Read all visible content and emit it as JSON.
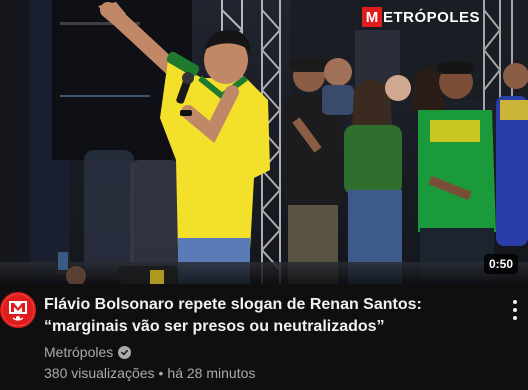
{
  "thumbnail": {
    "logo_initial": "M",
    "logo_rest": "ETRÓPOLES",
    "duration": "0:50"
  },
  "video": {
    "title": "Flávio Bolsonaro repete slogan de Renan Santos: “marginais vão ser presos ou neutralizados”",
    "channel": "Metrópoles",
    "views": "380 visualizações",
    "separator": "•",
    "age": "há 28 minutos"
  },
  "colors": {
    "background": "#0f0f0f",
    "brand_red": "#e01d1d",
    "text_primary": "#f1f1f1",
    "text_secondary": "#aaaaaa"
  },
  "icons": [
    "channel-avatar-icon",
    "verified-icon",
    "more-options-icon"
  ]
}
